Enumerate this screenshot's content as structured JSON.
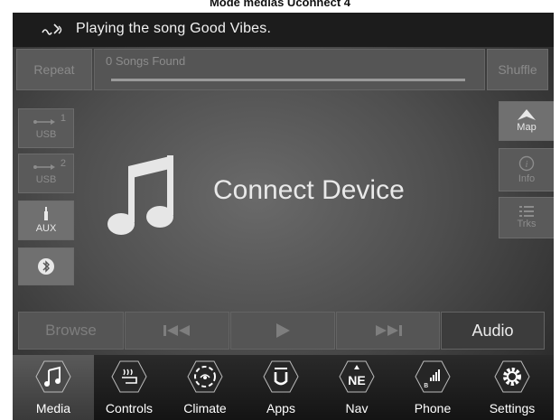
{
  "caption": "Mode médias Uconnect 4",
  "status": {
    "text": "Playing the song Good Vibes.",
    "icon": "voice-command-icon"
  },
  "player": {
    "repeat_label": "Repeat",
    "songs_found": "0 Songs Found",
    "shuffle_label": "Shuffle",
    "progress": 0,
    "connect_text": "Connect Device",
    "note_icon": "music-note-icon"
  },
  "sources": [
    {
      "label": "USB",
      "badge": "1",
      "icon": "usb-icon",
      "enabled": false
    },
    {
      "label": "USB",
      "badge": "2",
      "icon": "usb-icon",
      "enabled": false
    },
    {
      "label": "AUX",
      "icon": "aux-icon",
      "enabled": true
    },
    {
      "label": "",
      "icon": "bluetooth-icon",
      "enabled": true
    }
  ],
  "right_buttons": [
    {
      "label": "Map",
      "icon": "map-arrow-icon",
      "enabled": true
    },
    {
      "label": "Info",
      "icon": "info-icon",
      "enabled": false
    },
    {
      "label": "Trks",
      "icon": "tracks-list-icon",
      "enabled": false
    }
  ],
  "controls": {
    "browse_label": "Browse",
    "prev_icon": "skip-back-icon",
    "play_icon": "play-icon",
    "next_icon": "skip-forward-icon",
    "audio_label": "Audio"
  },
  "nav": [
    {
      "label": "Media",
      "icon": "music-note-icon",
      "selected": true
    },
    {
      "label": "Controls",
      "icon": "seat-heat-icon",
      "selected": false
    },
    {
      "label": "Climate",
      "icon": "climate-icon",
      "selected": false
    },
    {
      "label": "Apps",
      "icon": "apps-u-icon",
      "selected": false
    },
    {
      "label": "Nav",
      "icon": "compass-icon",
      "compass": "NE",
      "selected": false
    },
    {
      "label": "Phone",
      "icon": "phone-signal-icon",
      "selected": false
    },
    {
      "label": "Settings",
      "icon": "gear-icon",
      "selected": false
    }
  ]
}
